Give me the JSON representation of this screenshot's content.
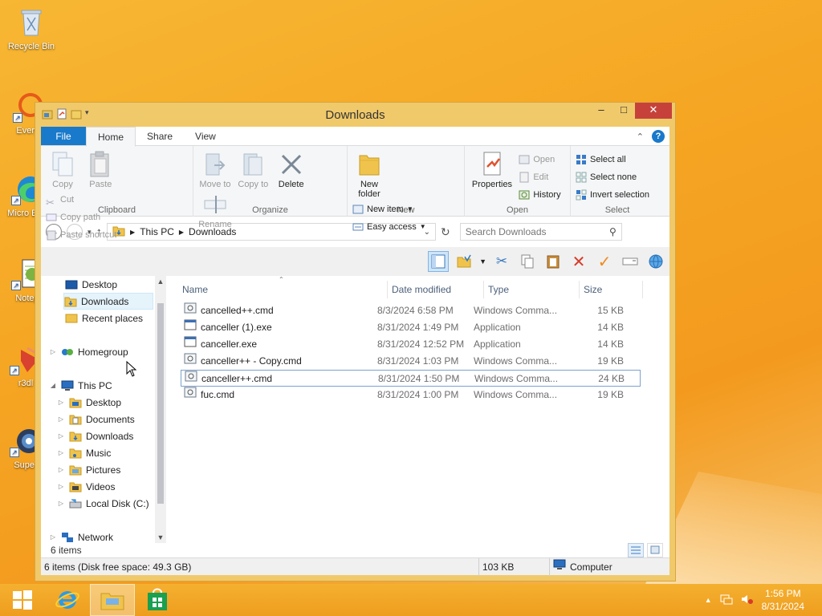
{
  "desktop": {
    "icons": [
      {
        "label": "Recycle Bin"
      },
      {
        "label": "Everyt"
      },
      {
        "label": "Micro Edg"
      },
      {
        "label": "Notep"
      },
      {
        "label": "r3dl"
      },
      {
        "label": "Super"
      }
    ]
  },
  "window": {
    "title": "Downloads",
    "controls": {
      "minimize": "‒",
      "maximize": "□",
      "close": "✕"
    }
  },
  "ribbon": {
    "tabs": [
      "File",
      "Home",
      "Share",
      "View"
    ],
    "clipboard": {
      "copy": "Copy",
      "paste": "Paste",
      "cut": "Cut",
      "copy_path": "Copy path",
      "paste_shortcut": "Paste shortcut",
      "label": "Clipboard"
    },
    "organize": {
      "move_to": "Move to",
      "copy_to": "Copy to",
      "delete": "Delete",
      "rename": "Rename",
      "label": "Organize"
    },
    "new": {
      "new_folder": "New folder",
      "new_item": "New item",
      "easy_access": "Easy access",
      "label": "New"
    },
    "open": {
      "properties": "Properties",
      "open": "Open",
      "edit": "Edit",
      "history": "History",
      "label": "Open"
    },
    "select": {
      "select_all": "Select all",
      "select_none": "Select none",
      "invert_selection": "Invert selection",
      "label": "Select"
    }
  },
  "address": {
    "crumbs": [
      "This PC",
      "Downloads"
    ],
    "search_placeholder": "Search Downloads"
  },
  "nav": {
    "items": [
      {
        "label": "Desktop"
      },
      {
        "label": "Downloads"
      },
      {
        "label": "Recent places"
      },
      {
        "label": "Homegroup"
      },
      {
        "label": "This PC"
      },
      {
        "label": "Desktop"
      },
      {
        "label": "Documents"
      },
      {
        "label": "Downloads"
      },
      {
        "label": "Music"
      },
      {
        "label": "Pictures"
      },
      {
        "label": "Videos"
      },
      {
        "label": "Local Disk (C:)"
      },
      {
        "label": "Network"
      }
    ]
  },
  "files": {
    "columns": [
      "Name",
      "Date modified",
      "Type",
      "Size"
    ],
    "rows": [
      {
        "name": "cancelled++.cmd",
        "date": "8/3/2024 6:58 PM",
        "type": "Windows Comma...",
        "size": "15 KB"
      },
      {
        "name": "canceller (1).exe",
        "date": "8/31/2024 1:49 PM",
        "type": "Application",
        "size": "14 KB"
      },
      {
        "name": "canceller.exe",
        "date": "8/31/2024 12:52 PM",
        "type": "Application",
        "size": "14 KB"
      },
      {
        "name": "canceller++ - Copy.cmd",
        "date": "8/31/2024 1:03 PM",
        "type": "Windows Comma...",
        "size": "19 KB"
      },
      {
        "name": "canceller++.cmd",
        "date": "8/31/2024 1:50 PM",
        "type": "Windows Comma...",
        "size": "24 KB"
      },
      {
        "name": "fuc.cmd",
        "date": "8/31/2024 1:00 PM",
        "type": "Windows Comma...",
        "size": "19 KB"
      }
    ]
  },
  "status": {
    "item_count": "6 items",
    "disk": "6 items (Disk free space: 49.3 GB)",
    "size": "103 KB",
    "location": "Computer"
  },
  "taskbar": {
    "time": "1:56 PM",
    "date": "8/31/2024"
  },
  "colors": {
    "accent": "#1979ca",
    "desktop": "#f5a623",
    "close": "#c7413b"
  }
}
